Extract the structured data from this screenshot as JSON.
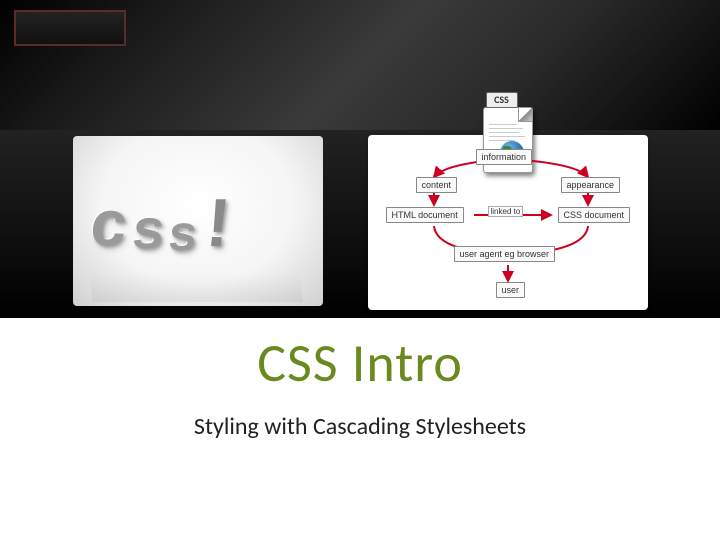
{
  "title": "CSS Intro",
  "subtitle": "Styling with Cascading Stylesheets",
  "left_image": {
    "text": "css!",
    "alt": "3D glossy CSS letters"
  },
  "css_doc_icon": {
    "label": "CSS"
  },
  "diagram": {
    "nodes": {
      "information": "information",
      "content": "content",
      "appearance": "appearance",
      "html_doc": "HTML document",
      "css_doc": "CSS document",
      "linked_to": "linked to",
      "user_agent": "user agent eg browser",
      "user": "user"
    }
  }
}
